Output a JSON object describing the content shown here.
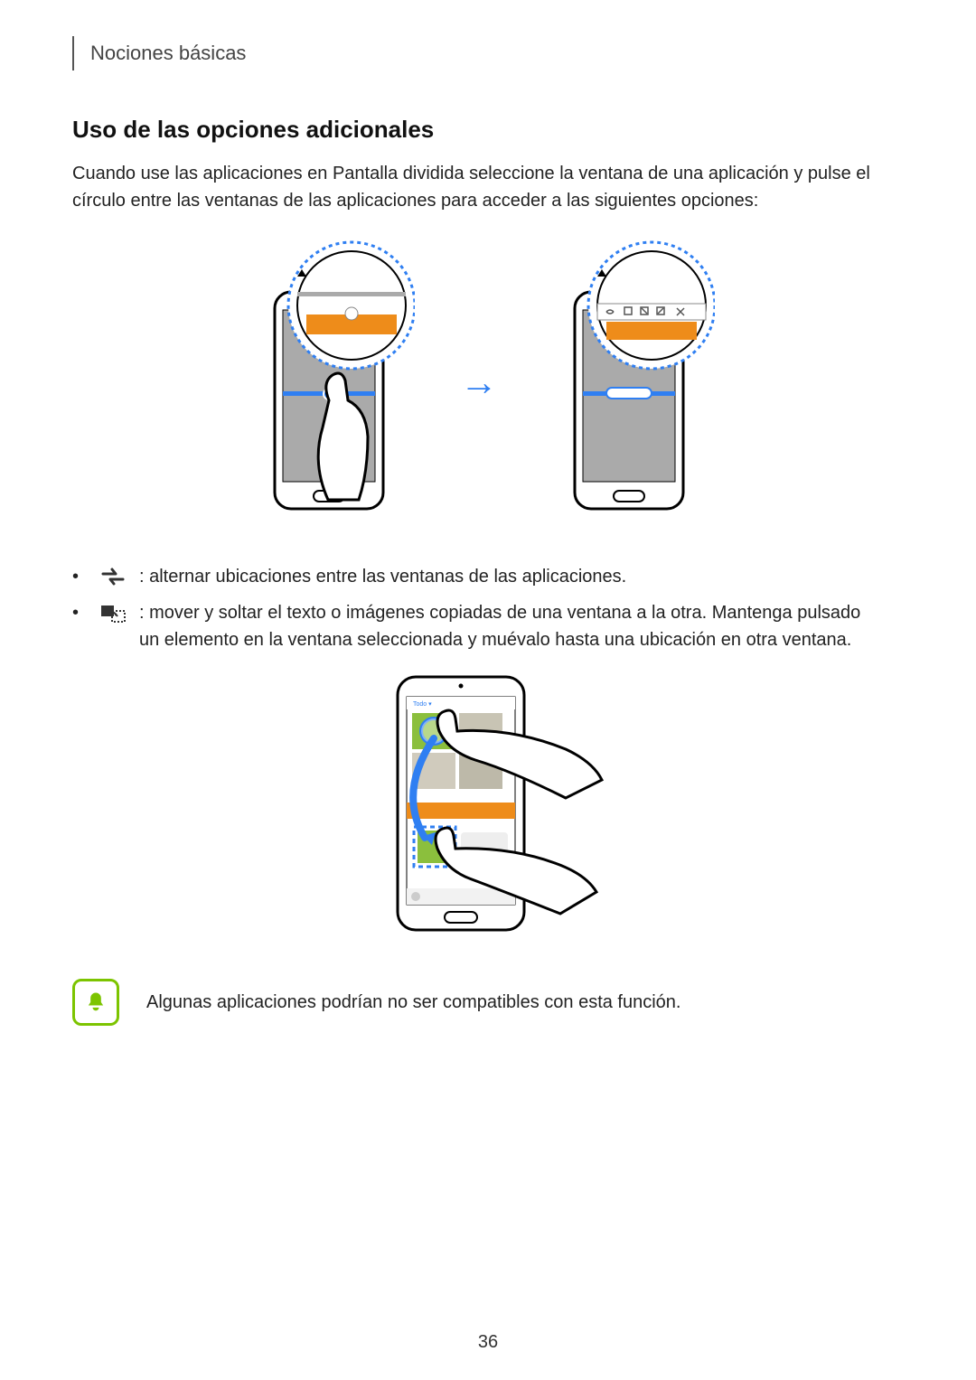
{
  "header": "Nociones básicas",
  "section_title": "Uso de las opciones adicionales",
  "intro_text": "Cuando use las aplicaciones en Pantalla dividida seleccione la ventana de una aplicación y pulse el círculo entre las ventanas de las aplicaciones para acceder a las siguientes opciones:",
  "bullets": [
    {
      "icon": "swap-windows-icon",
      "text": " : alternar ubicaciones entre las ventanas de las aplicaciones."
    },
    {
      "icon": "drag-content-icon",
      "text": " : mover y soltar el texto o imágenes copiadas de una ventana a la otra. Mantenga pulsado un elemento en la ventana seleccionada y muévalo hasta una ubicación en otra ventana."
    }
  ],
  "note_text": "Algunas aplicaciones podrían no ser compatibles con esta función.",
  "page_number": "36"
}
